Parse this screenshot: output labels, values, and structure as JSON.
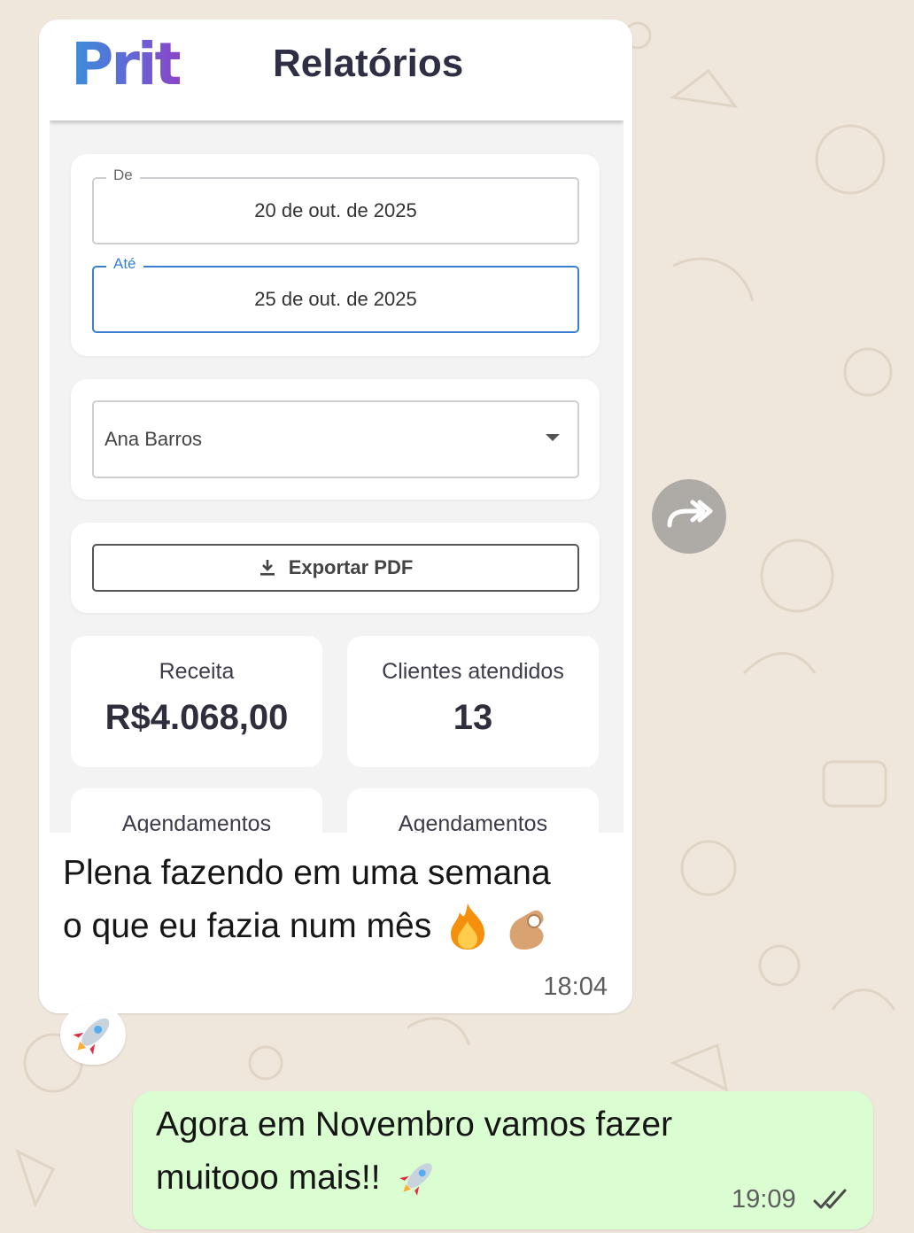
{
  "app": {
    "logo_text": "Prit",
    "title": "Relatórios"
  },
  "date_range": {
    "from_label": "De",
    "from_value": "20 de out. de 2025",
    "to_label": "Até",
    "to_value": "25 de out. de 2025"
  },
  "professional_select": {
    "value": "Ana Barros"
  },
  "export": {
    "label": "Exportar PDF",
    "icon": "download-icon"
  },
  "stats": [
    {
      "title": "Receita",
      "value": "R$4.068,00"
    },
    {
      "title": "Clientes atendidos",
      "value": "13"
    },
    {
      "title": "Agendamentos"
    },
    {
      "title": "Agendamentos"
    }
  ],
  "chat": {
    "incoming": {
      "line1": "Plena fazendo em uma semana",
      "line2": "o que eu fazia num mês",
      "emojis": [
        "fire-emoji",
        "ok-hand-emoji"
      ],
      "time": "18:04",
      "reaction": "rocket-emoji"
    },
    "outgoing": {
      "line1": "Agora em Novembro vamos fazer",
      "line2": "muitooo mais!!",
      "emoji": "rocket-emoji",
      "time": "19:09",
      "status": "read-ticks"
    },
    "forward_icon": "forward-icon"
  },
  "colors": {
    "wallpaper": "#efe7dc",
    "incoming_bubble": "#ffffff",
    "outgoing_bubble": "#dafdd1",
    "focus_blue": "#3b7fd0",
    "logo_gradient": [
      "#3a8fd8",
      "#8a45c8"
    ]
  }
}
